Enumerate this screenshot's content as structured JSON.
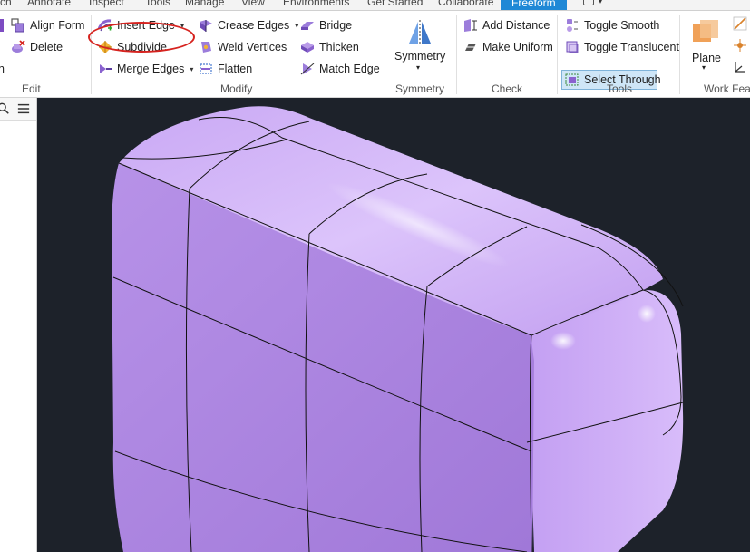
{
  "tabs": [
    {
      "label": "ch",
      "active": false
    },
    {
      "label": "Annotate",
      "active": false
    },
    {
      "label": "Inspect",
      "active": false
    },
    {
      "label": "Tools",
      "active": false
    },
    {
      "label": "Manage",
      "active": false
    },
    {
      "label": "View",
      "active": false
    },
    {
      "label": "Environments",
      "active": false
    },
    {
      "label": "Get Started",
      "active": false
    },
    {
      "label": "Collaborate",
      "active": false
    },
    {
      "label": "Freeform",
      "active": true
    }
  ],
  "edit": {
    "align_form": "Align Form",
    "delete": "Delete",
    "label": "Edit"
  },
  "modify": {
    "insert_edge": "Insert Edge",
    "subdivide": "Subdivide",
    "merge_edges": "Merge Edges",
    "crease_edges": "Crease Edges",
    "weld_vertices": "Weld Vertices",
    "flatten": "Flatten",
    "bridge": "Bridge",
    "thicken": "Thicken",
    "match_edge": "Match Edge",
    "label": "Modify"
  },
  "symmetry": {
    "button": "Symmetry",
    "label": "Symmetry"
  },
  "check": {
    "add_distance": "Add Distance",
    "make_uniform": "Make Uniform",
    "label": "Check"
  },
  "tools": {
    "toggle_smooth": "Toggle Smooth",
    "toggle_translucent": "Toggle Translucent",
    "select_through": "Select Through",
    "label": "Tools"
  },
  "work_features": {
    "plane": "Plane",
    "label": "Work Feat"
  },
  "colors": {
    "accent": "#1f88d6",
    "viewport_bg": "#1d222a",
    "model": "#b48ae6",
    "highlight": "#d6231f"
  }
}
